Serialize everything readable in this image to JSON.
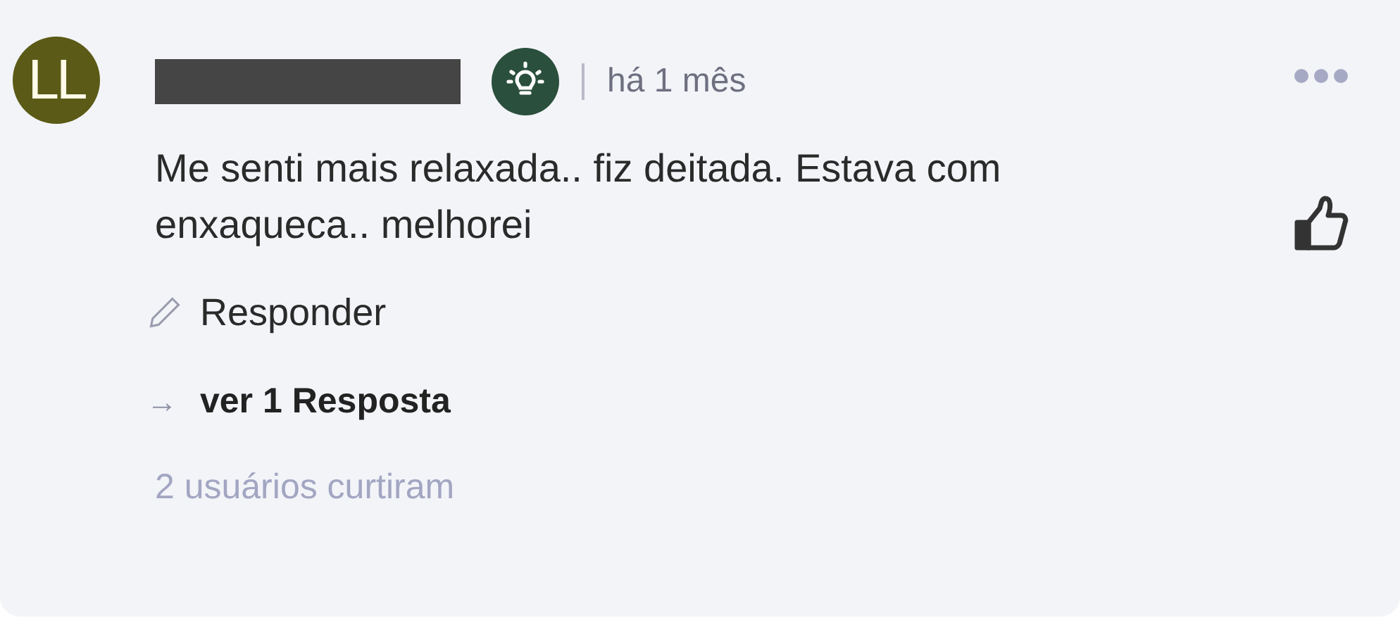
{
  "comment": {
    "avatar_initials": "LL",
    "time": "há 1 mês",
    "text": "Me senti mais relaxada.. fiz deitada. Estava com enxaqueca.. melhorei",
    "reply_action": "Responder",
    "arrow": "→",
    "view_replies": "ver 1 Resposta",
    "likes": "2 usuários curtiram"
  }
}
